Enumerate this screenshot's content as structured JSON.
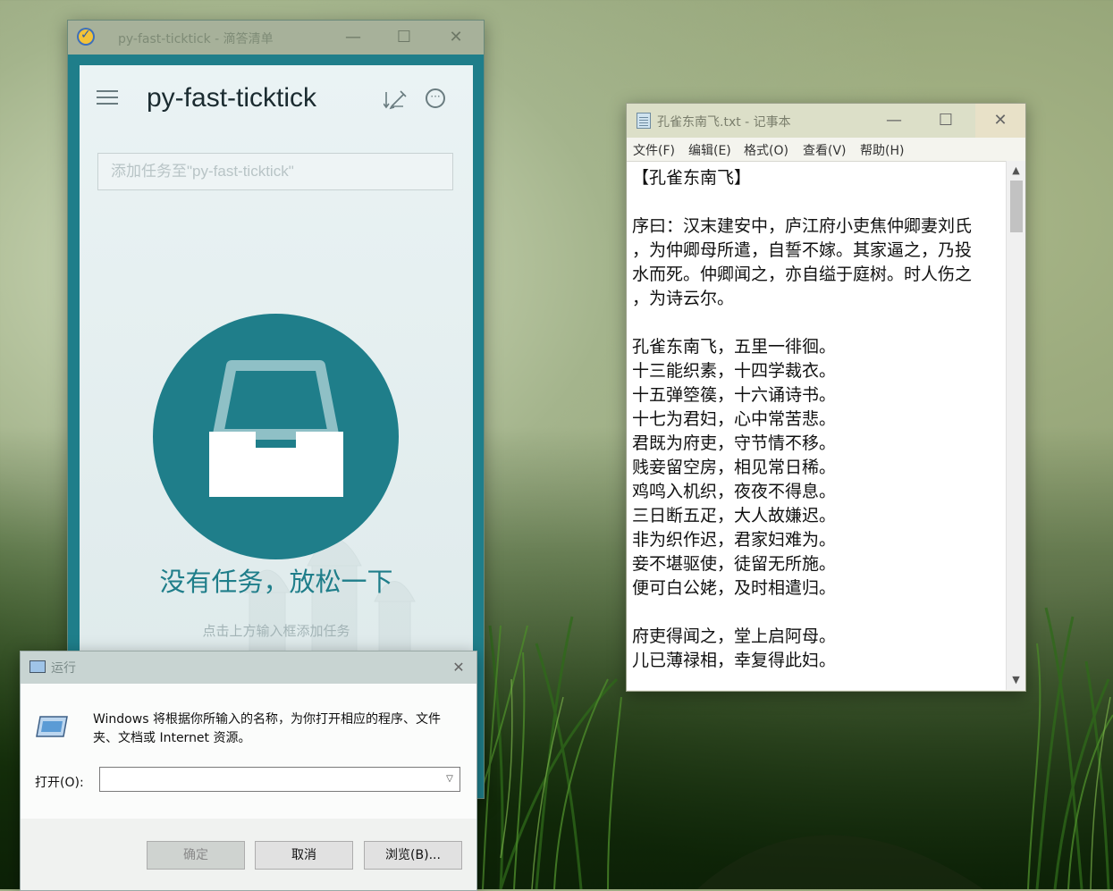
{
  "ticktick": {
    "window_title": "py-fast-ticktick - 滴答清单",
    "heading": "py-fast-ticktick",
    "input_placeholder": "添加任务至\"py-fast-ticktick\"",
    "empty_title": "没有任务，放松一下",
    "empty_subtitle": "点击上方输入框添加任务",
    "icons": [
      "menu-icon",
      "sort-icon",
      "more-icon",
      "inbox-icon"
    ],
    "accent_color": "#1f7e8a"
  },
  "notepad": {
    "window_title": "孔雀东南飞.txt - 记事本",
    "menu": [
      "文件(F)",
      "编辑(E)",
      "格式(O)",
      "查看(V)",
      "帮助(H)"
    ],
    "lines": [
      "【孔雀东南飞】",
      "",
      "序曰：汉末建安中，庐江府小吏焦仲卿妻刘氏",
      "，为仲卿母所遣，自誓不嫁。其家逼之，乃投",
      "水而死。仲卿闻之，亦自缢于庭树。时人伤之",
      "，为诗云尔。",
      "",
      "孔雀东南飞，五里一徘徊。",
      "十三能织素，十四学裁衣。",
      "十五弹箜篌，十六诵诗书。",
      "十七为君妇，心中常苦悲。",
      "君既为府吏，守节情不移。",
      "贱妾留空房，相见常日稀。",
      "鸡鸣入机织，夜夜不得息。",
      "三日断五疋，大人故嫌迟。",
      "非为织作迟，君家妇难为。",
      "妾不堪驱使，徒留无所施。",
      "便可白公姥，及时相遣归。",
      "",
      "府吏得闻之，堂上启阿母。",
      "儿已薄禄相，幸复得此妇。"
    ]
  },
  "run_dialog": {
    "window_title": "运行",
    "description": "Windows 将根据你所输入的名称，为你打开相应的程序、文件夹、文档或 Internet 资源。",
    "open_label": "打开(O):",
    "open_value": "",
    "buttons": {
      "ok": "确定",
      "cancel": "取消",
      "browse": "浏览(B)..."
    }
  }
}
